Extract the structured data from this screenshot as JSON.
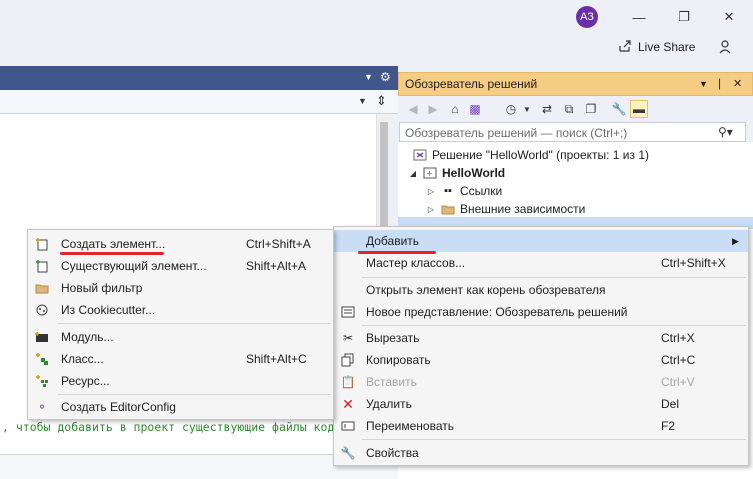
{
  "title_bar": {
    "avatar_initials": "АЗ",
    "live_share_label": "Live Share"
  },
  "editor": {
    "code_line": ", чтобы добавить в проект существующие файлы кода"
  },
  "solution_explorer": {
    "title": "Обозреватель решений",
    "search_placeholder": "Обозреватель решений — поиск (Ctrl+;)",
    "tree": [
      {
        "label": "Решение \"HelloWorld\" (проекты: 1 из 1)"
      },
      {
        "label": "HelloWorld"
      },
      {
        "label": "Ссылки"
      },
      {
        "label": "Внешние зависимости"
      }
    ]
  },
  "context_menu_main": {
    "items": [
      {
        "label": "Добавить",
        "shortcut": ""
      },
      {
        "label": "Мастер классов...",
        "shortcut": "Ctrl+Shift+X"
      },
      {
        "label": "Открыть элемент как корень обозревателя",
        "shortcut": ""
      },
      {
        "label": "Новое представление: Обозреватель решений",
        "shortcut": ""
      },
      {
        "label": "Вырезать",
        "shortcut": "Ctrl+X"
      },
      {
        "label": "Копировать",
        "shortcut": "Ctrl+C"
      },
      {
        "label": "Вставить",
        "shortcut": "Ctrl+V"
      },
      {
        "label": "Удалить",
        "shortcut": "Del"
      },
      {
        "label": "Переименовать",
        "shortcut": "F2"
      },
      {
        "label": "Свойства",
        "shortcut": ""
      }
    ]
  },
  "context_menu_add": {
    "items": [
      {
        "label": "Создать элемент...",
        "shortcut": "Ctrl+Shift+A"
      },
      {
        "label": "Существующий элемент...",
        "shortcut": "Shift+Alt+A"
      },
      {
        "label": "Новый фильтр",
        "shortcut": ""
      },
      {
        "label": "Из Cookiecutter...",
        "shortcut": ""
      },
      {
        "label": "Модуль...",
        "shortcut": ""
      },
      {
        "label": "Класс...",
        "shortcut": "Shift+Alt+C"
      },
      {
        "label": "Ресурс...",
        "shortcut": ""
      },
      {
        "label": "Создать EditorConfig",
        "shortcut": ""
      }
    ]
  },
  "colors": {
    "accent_header": "#40568d",
    "se_title_active": "#f5cc84",
    "menu_hover": "#c9def5",
    "annotation_red": "#e0262a"
  }
}
